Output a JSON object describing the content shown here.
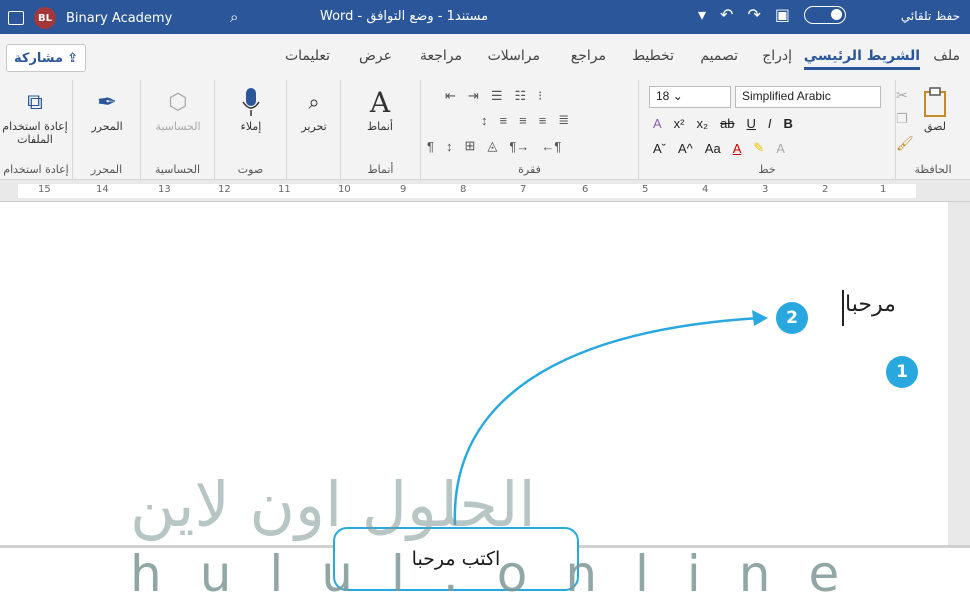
{
  "titlebar": {
    "user_initials": "BL",
    "user_name": "Binary Academy",
    "doc_title": "مستند1 - وضع التوافق - Word",
    "autosave_label": "حفظ تلقائي"
  },
  "tabs": [
    "ملف",
    "الشريط الرئيسي",
    "إدراج",
    "تصميم",
    "تخطيط",
    "مراجع",
    "مراسلات",
    "مراجعة",
    "عرض",
    "تعليمات"
  ],
  "active_tab": "الشريط الرئيسي",
  "share_label": "مشاركة",
  "ribbon": {
    "clipboard": {
      "label": "الحافظة",
      "paste_label": "لصق"
    },
    "font": {
      "label": "خط",
      "font_name": "Simplified Arabic",
      "font_size": "18"
    },
    "paragraph": {
      "label": "فقرة"
    },
    "styles": {
      "label": "أنماط",
      "styles_button": "أنماط"
    },
    "editing": {
      "label": "تحرير"
    },
    "voice": {
      "label": "صوت",
      "dictate_label": "إملاء"
    },
    "sensitivity": {
      "label": "الحساسية",
      "button_label": "الحساسية"
    },
    "editor": {
      "label": "المحرر",
      "button_label": "المحرر"
    },
    "reuse": {
      "label": "إعادة استخدام",
      "button_label": "إعادة استخدام الملفات"
    }
  },
  "ruler_numbers": [
    "15",
    "14",
    "13",
    "12",
    "11",
    "10",
    "9",
    "8",
    "7",
    "6",
    "5",
    "4",
    "3",
    "2",
    "1"
  ],
  "document": {
    "typed_text": "مرحبا"
  },
  "annotations": {
    "badge_1": "1",
    "badge_2": "2",
    "callout_text": "اكتب مرحبا",
    "accent_color": "#29a8e0"
  },
  "watermark": {
    "latin": "hulul.online",
    "arabic": "الحلول اون لاين"
  }
}
